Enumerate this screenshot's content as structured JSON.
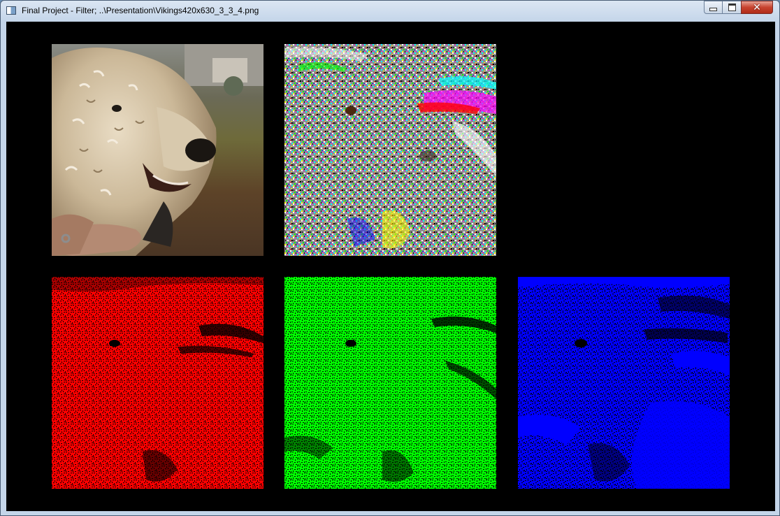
{
  "window": {
    "title": "Final Project - Filter; ..\\Presentation\\Vikings420x630_3_3_4.png",
    "controls": {
      "minimize": "minimize",
      "maximize": "maximize",
      "close": "close"
    }
  },
  "panels": [
    {
      "name": "original",
      "icon": "image-icon"
    },
    {
      "name": "combined-noise"
    },
    {
      "name": "red-channel",
      "color": "#ff0000"
    },
    {
      "name": "green-channel",
      "color": "#00ff00"
    },
    {
      "name": "blue-channel",
      "color": "#0000ff"
    }
  ],
  "colors": {
    "background": "#000000",
    "titlebar": "#c4d5e9",
    "close_button": "#c7432f"
  }
}
